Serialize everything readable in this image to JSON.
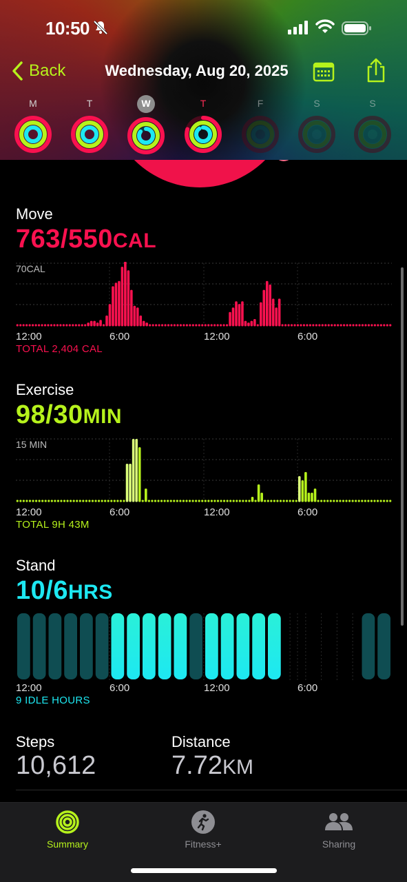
{
  "status_bar": {
    "time": "10:50"
  },
  "nav": {
    "back_label": "Back",
    "title": "Wednesday, Aug 20, 2025"
  },
  "week": [
    {
      "label": "M",
      "state": "past"
    },
    {
      "label": "T",
      "state": "past"
    },
    {
      "label": "W",
      "state": "selected"
    },
    {
      "label": "T",
      "state": "today"
    },
    {
      "label": "F",
      "state": "future"
    },
    {
      "label": "S",
      "state": "future"
    },
    {
      "label": "S",
      "state": "future"
    }
  ],
  "move": {
    "title": "Move",
    "value": "763/550",
    "unit": "CAL",
    "scale_label": "70CAL",
    "total": "TOTAL 2,404 CAL",
    "color": "#fa114f",
    "max": 70,
    "values": [
      0,
      0,
      0,
      0,
      0,
      0,
      0,
      0,
      0,
      0,
      0,
      0,
      0,
      0,
      0,
      0,
      0,
      0,
      0,
      0,
      0,
      0,
      0,
      3,
      5,
      5,
      3,
      6,
      0,
      11,
      24,
      44,
      48,
      50,
      66,
      72,
      62,
      40,
      22,
      20,
      11,
      5,
      3,
      0,
      0,
      0,
      0,
      0,
      0,
      0,
      0,
      0,
      0,
      0,
      0,
      0,
      0,
      0,
      0,
      0,
      0,
      0,
      0,
      0,
      0,
      0,
      0,
      0,
      0,
      15,
      20,
      27,
      24,
      27,
      5,
      3,
      5,
      7,
      0,
      26,
      40,
      50,
      46,
      30,
      20,
      30,
      0,
      0,
      0,
      0,
      0,
      0,
      0,
      0,
      0,
      0,
      0,
      0,
      0,
      0,
      0,
      0,
      0,
      0,
      0,
      0,
      0,
      0,
      0,
      0,
      0,
      0,
      0,
      0,
      0,
      0,
      0,
      0,
      0,
      0,
      0,
      0
    ]
  },
  "exercise": {
    "title": "Exercise",
    "value": "98/30",
    "unit": "MIN",
    "scale_label": "15 MIN",
    "total": "TOTAL 9H 43M",
    "color": "#b6f21c",
    "highlight": "#dcff7a",
    "max": 15,
    "values": [
      0,
      0,
      0,
      0,
      0,
      0,
      0,
      0,
      0,
      0,
      0,
      0,
      0,
      0,
      0,
      0,
      0,
      0,
      0,
      0,
      0,
      0,
      0,
      0,
      0,
      0,
      0,
      0,
      0,
      0,
      0,
      0,
      0,
      0,
      0,
      9,
      9,
      15,
      15,
      13,
      0,
      3,
      0,
      0,
      0,
      0,
      0,
      0,
      0,
      0,
      0,
      0,
      0,
      0,
      0,
      0,
      0,
      0,
      0,
      0,
      0,
      0,
      0,
      0,
      0,
      0,
      0,
      0,
      0,
      0,
      0,
      0,
      0,
      0,
      0,
      1,
      0,
      4,
      2,
      0,
      0,
      0,
      0,
      0,
      0,
      0,
      0,
      0,
      0,
      0,
      6,
      5,
      7,
      2,
      2,
      3,
      0,
      0,
      0,
      0,
      0,
      0,
      0,
      0,
      0,
      0,
      0,
      0,
      0,
      0,
      0,
      0,
      0,
      0,
      0,
      0,
      0,
      0,
      0,
      0
    ],
    "light_indices": [
      35,
      36,
      37,
      38,
      89,
      90
    ]
  },
  "stand": {
    "title": "Stand",
    "value": "10/6",
    "unit": "HRS",
    "idle": "9 IDLE HOURS",
    "hours": [
      0,
      0,
      0,
      0,
      0,
      0,
      1,
      1,
      1,
      1,
      1,
      0,
      1,
      1,
      1,
      1,
      1,
      -1,
      -1,
      -1,
      -1,
      -1,
      0,
      0
    ],
    "active_color": "#1de8f2",
    "idle_color": "#0f4d52"
  },
  "axis_labels": [
    "12:00",
    "6:00",
    "12:00",
    "6:00"
  ],
  "steps": {
    "title": "Steps",
    "value": "10,612"
  },
  "distance": {
    "title": "Distance",
    "value": "7.72",
    "unit": "KM"
  },
  "tabs": [
    {
      "label": "Summary",
      "icon": "activity-rings-icon",
      "active": true
    },
    {
      "label": "Fitness+",
      "icon": "running-figure-icon",
      "active": false
    },
    {
      "label": "Sharing",
      "icon": "people-icon",
      "active": false
    }
  ]
}
